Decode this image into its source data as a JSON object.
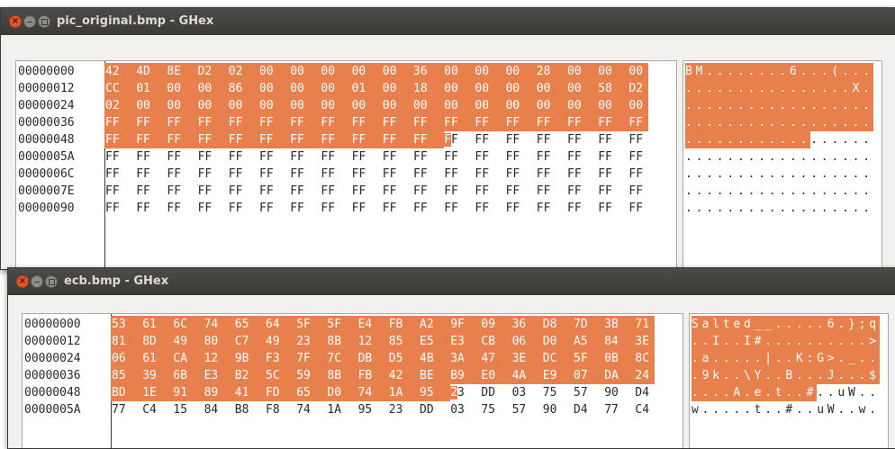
{
  "window1": {
    "title": "pic_original.bmp - GHex",
    "rows": [
      {
        "offset": "00000000",
        "bytes": [
          "42",
          "4D",
          "8E",
          "D2",
          "02",
          "00",
          "00",
          "00",
          "00",
          "00",
          "36",
          "00",
          "00",
          "00",
          "28",
          "00",
          "00",
          "00"
        ],
        "ascii": "BM........6...(..."
      },
      {
        "offset": "00000012",
        "bytes": [
          "CC",
          "01",
          "00",
          "00",
          "86",
          "00",
          "00",
          "00",
          "01",
          "00",
          "18",
          "00",
          "00",
          "00",
          "00",
          "00",
          "58",
          "D2"
        ],
        "ascii": "................X."
      },
      {
        "offset": "00000024",
        "bytes": [
          "02",
          "00",
          "00",
          "00",
          "00",
          "00",
          "00",
          "00",
          "00",
          "00",
          "00",
          "00",
          "00",
          "00",
          "00",
          "00",
          "00",
          "00"
        ],
        "ascii": ".................."
      },
      {
        "offset": "00000036",
        "bytes": [
          "FF",
          "FF",
          "FF",
          "FF",
          "FF",
          "FF",
          "FF",
          "FF",
          "FF",
          "FF",
          "FF",
          "FF",
          "FF",
          "FF",
          "FF",
          "FF",
          "FF",
          "FF"
        ],
        "ascii": ".................."
      },
      {
        "offset": "00000048",
        "bytes": [
          "FF",
          "FF",
          "FF",
          "FF",
          "FF",
          "FF",
          "FF",
          "FF",
          "FF",
          "FF",
          "FF",
          "FF",
          "FF",
          "FF",
          "FF",
          "FF",
          "FF",
          "FF"
        ],
        "ascii": ".................."
      },
      {
        "offset": "0000005A",
        "bytes": [
          "FF",
          "FF",
          "FF",
          "FF",
          "FF",
          "FF",
          "FF",
          "FF",
          "FF",
          "FF",
          "FF",
          "FF",
          "FF",
          "FF",
          "FF",
          "FF",
          "FF",
          "FF"
        ],
        "ascii": ".................."
      },
      {
        "offset": "0000006C",
        "bytes": [
          "FF",
          "FF",
          "FF",
          "FF",
          "FF",
          "FF",
          "FF",
          "FF",
          "FF",
          "FF",
          "FF",
          "FF",
          "FF",
          "FF",
          "FF",
          "FF",
          "FF",
          "FF"
        ],
        "ascii": ".................."
      },
      {
        "offset": "0000007E",
        "bytes": [
          "FF",
          "FF",
          "FF",
          "FF",
          "FF",
          "FF",
          "FF",
          "FF",
          "FF",
          "FF",
          "FF",
          "FF",
          "FF",
          "FF",
          "FF",
          "FF",
          "FF",
          "FF"
        ],
        "ascii": ".................."
      },
      {
        "offset": "00000090",
        "bytes": [
          "FF",
          "FF",
          "FF",
          "FF",
          "FF",
          "FF",
          "FF",
          "FF",
          "FF",
          "FF",
          "FF",
          "FF",
          "FF",
          "FF",
          "FF",
          "FF",
          "FF",
          "FF"
        ],
        "ascii": ".................."
      }
    ],
    "selected_byte_count": 84,
    "cursor_byte_index": 83
  },
  "window2": {
    "title": "ecb.bmp - GHex",
    "rows": [
      {
        "offset": "00000000",
        "bytes": [
          "53",
          "61",
          "6C",
          "74",
          "65",
          "64",
          "5F",
          "5F",
          "E4",
          "FB",
          "A2",
          "9F",
          "09",
          "36",
          "D8",
          "7D",
          "3B",
          "71"
        ],
        "ascii": "Salted__.....6.};q"
      },
      {
        "offset": "00000012",
        "bytes": [
          "81",
          "8D",
          "49",
          "80",
          "C7",
          "49",
          "23",
          "8B",
          "12",
          "85",
          "E5",
          "E3",
          "CB",
          "06",
          "D0",
          "A5",
          "84",
          "3E"
        ],
        "ascii": "..I..I#..........>"
      },
      {
        "offset": "00000024",
        "bytes": [
          "06",
          "61",
          "CA",
          "12",
          "9B",
          "F3",
          "7F",
          "7C",
          "DB",
          "D5",
          "4B",
          "3A",
          "47",
          "3E",
          "DC",
          "5F",
          "0B",
          "8C"
        ],
        "ascii": ".a.....|..K:G>._.."
      },
      {
        "offset": "00000036",
        "bytes": [
          "85",
          "39",
          "6B",
          "E3",
          "B2",
          "5C",
          "59",
          "8B",
          "FB",
          "42",
          "BE",
          "B9",
          "E0",
          "4A",
          "E9",
          "07",
          "DA",
          "24"
        ],
        "ascii": ".9k..\\Y..B...J...$"
      },
      {
        "offset": "00000048",
        "bytes": [
          "BD",
          "1E",
          "91",
          "89",
          "41",
          "FD",
          "65",
          "D0",
          "74",
          "1A",
          "95",
          "23",
          "DD",
          "03",
          "75",
          "57",
          "90",
          "D4"
        ],
        "ascii": "....A.e.t..#..uW.."
      },
      {
        "offset": "0000005A",
        "bytes": [
          "77",
          "C4",
          "15",
          "84",
          "B8",
          "F8",
          "74",
          "1A",
          "95",
          "23",
          "DD",
          "03",
          "75",
          "57",
          "90",
          "D4",
          "77",
          "C4"
        ],
        "ascii": "w.....t..#..uW..w."
      }
    ],
    "selected_byte_count": 84,
    "cursor_byte_index": 83
  },
  "colors": {
    "selection": "#e8804d",
    "titlebar": "#3c3b37",
    "close_button": "#e0552b"
  }
}
